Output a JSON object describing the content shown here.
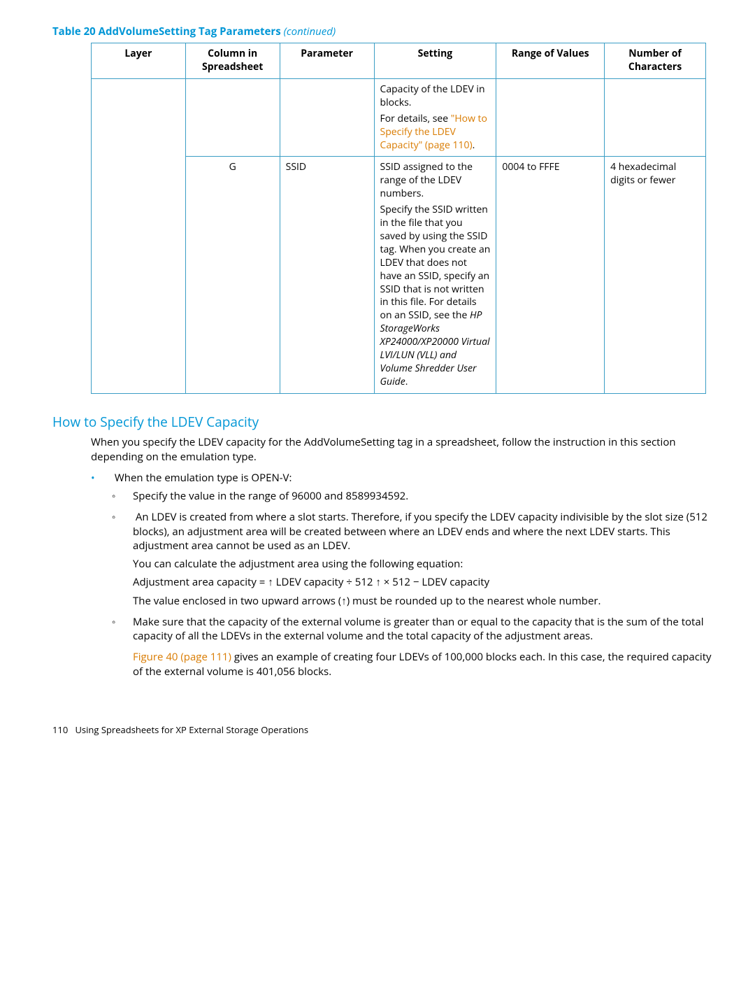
{
  "tableCaption": {
    "main": "Table 20 AddVolumeSetting Tag Parameters ",
    "cont": "(continued)"
  },
  "headers": [
    "Layer",
    "Column in Spreadsheet",
    "Parameter",
    "Setting",
    "Range of Values",
    "Number of Characters"
  ],
  "row1": {
    "settingPlain1": "Capacity of the LDEV in blocks.",
    "settingPlain2": "For details, see ",
    "settingLink": "\"How to Specify the LDEV Capacity\" (page 110)",
    "settingPlain3": "."
  },
  "row2": {
    "col": "G",
    "param": "SSID",
    "setting1": "SSID assigned to the range of the LDEV numbers.",
    "setting2a": "Specify the SSID written in the file that you saved by using the SSID tag. When you create an LDEV that does not have an SSID, specify an SSID that is not written in this file. For details on an SSID, see the ",
    "setting2b": "HP StorageWorks XP24000/XP20000 Virtual LVI/LUN (VLL) and Volume Shredder User Guide",
    "setting2c": ".",
    "range": "0004 to FFFE",
    "num": "4 hexadecimal digits or fewer"
  },
  "sectionTitle": "How to Specify the LDEV Capacity",
  "intro": "When you specify the LDEV capacity for the AddVolumeSetting tag in a spreadsheet, follow the instruction in this section depending on the emulation type.",
  "bullet1": "When the emulation type is OPEN-V:",
  "circ1": "Specify the value in the range of 96000 and 8589934592.",
  "circ2": "An LDEV is created from where a slot starts. Therefore, if you specify the LDEV capacity indivisible by the slot size (512 blocks), an adjustment area will be created between where an LDEV ends and where the next LDEV starts. This adjustment area cannot be used as an LDEV.",
  "calc1": "You can calculate the adjustment area using the following equation:",
  "calc2": "Adjustment area capacity = ↑ LDEV capacity ÷ 512 ↑ × 512 − LDEV capacity",
  "calc3": "The value enclosed in two upward arrows (↑) must be rounded up to the nearest whole number.",
  "circ3": "Make sure that the capacity of the external volume is greater than or equal to the capacity that is the sum of the total capacity of all the LDEVs in the external volume and the total capacity of the adjustment areas.",
  "figLink": "Figure 40 (page 111)",
  "figTail": " gives an example of creating four LDEVs of 100,000 blocks each. In this case, the required capacity of the external volume is 401,056 blocks.",
  "footerPage": "110",
  "footerText": "Using Spreadsheets for XP External Storage Operations"
}
